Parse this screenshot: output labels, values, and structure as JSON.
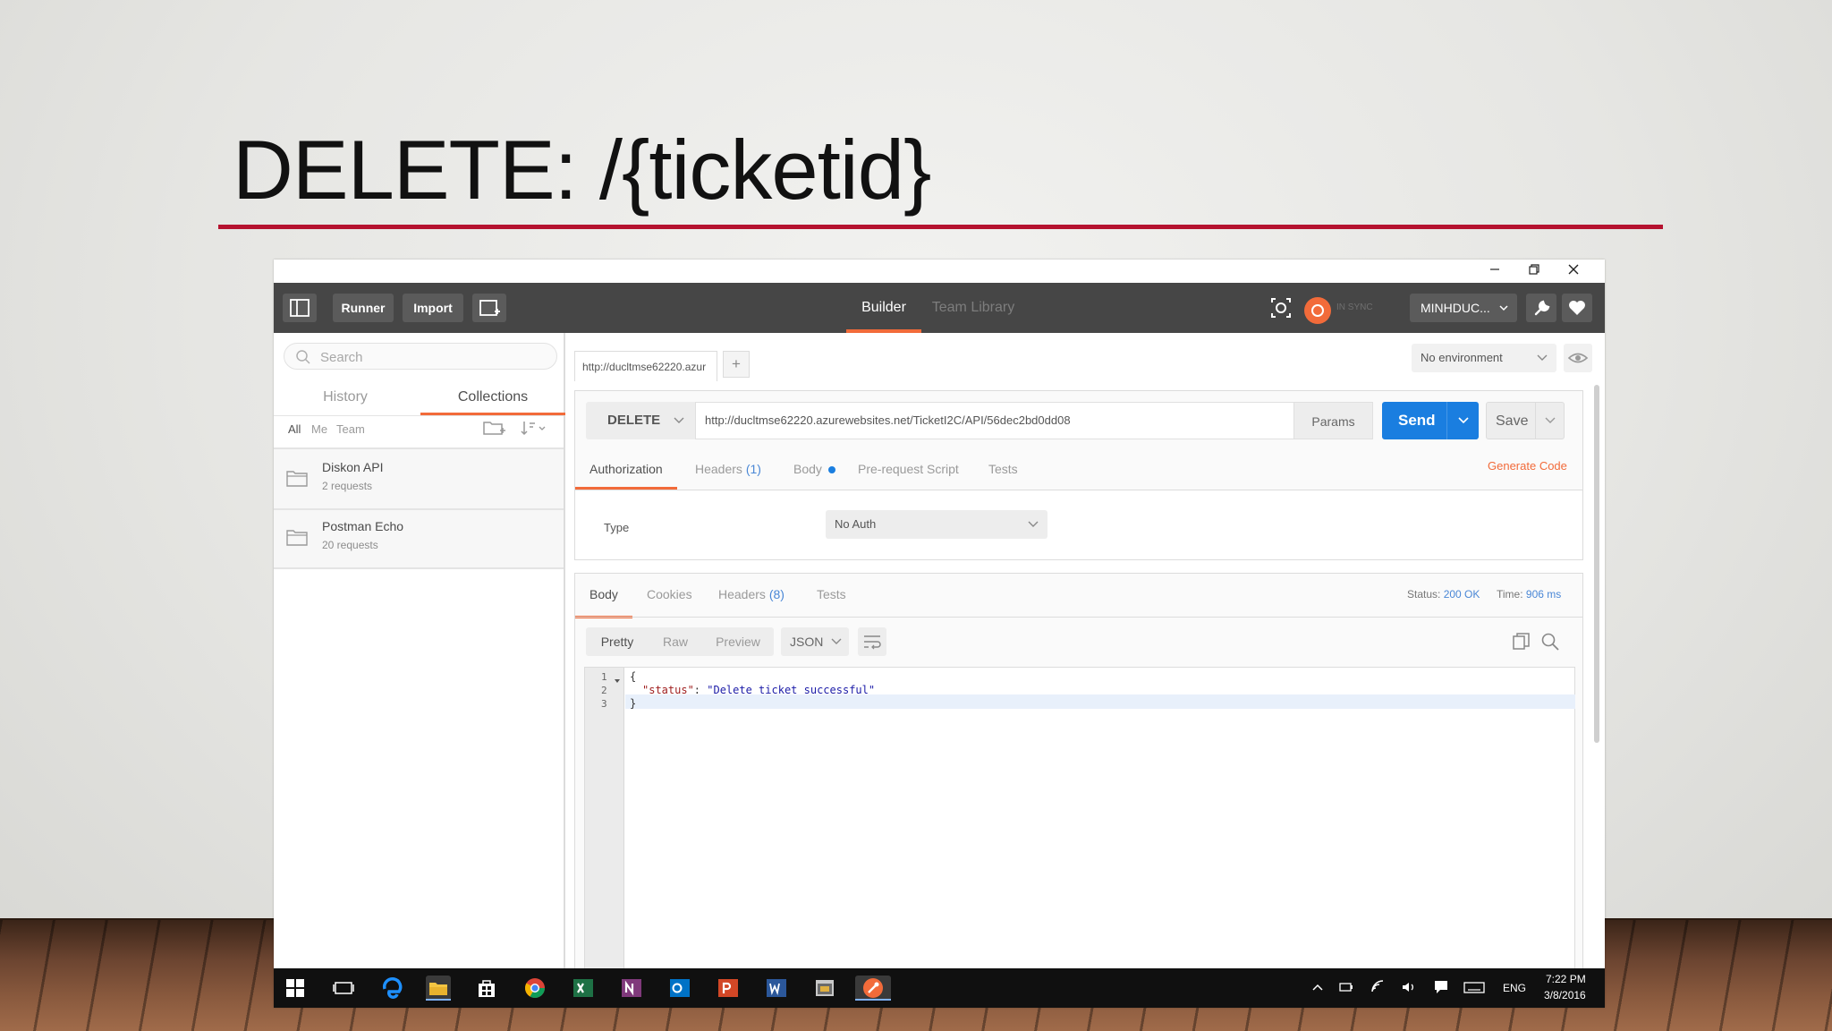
{
  "slide": {
    "title": "DELETE: /{ticketid}"
  },
  "toolbar": {
    "runner_label": "Runner",
    "import_label": "Import",
    "builder_tab": "Builder",
    "team_library_tab": "Team Library",
    "sync_status": "IN SYNC",
    "user_label": "MINHDUC..."
  },
  "sidebar": {
    "search_placeholder": "Search",
    "tabs": [
      "History",
      "Collections"
    ],
    "filters": [
      "All",
      "Me",
      "Team"
    ],
    "collections": [
      {
        "name": "Diskon API",
        "count": "2 requests"
      },
      {
        "name": "Postman Echo",
        "count": "20 requests"
      }
    ]
  },
  "request": {
    "tab_label": "http://ducltmse62220.azur",
    "add_tab": "+",
    "environment": "No environment",
    "method": "DELETE",
    "url": "http://ducltmse62220.azurewebsites.net/TicketI2C/API/56dec2bd0dd08",
    "params_label": "Params",
    "send_label": "Send",
    "save_label": "Save",
    "tabs": {
      "authorization": "Authorization",
      "headers": "Headers",
      "headers_count": "(1)",
      "body": "Body",
      "pre_request": "Pre-request Script",
      "tests": "Tests"
    },
    "generate_code": "Generate Code",
    "auth": {
      "type_label": "Type",
      "type_value": "No Auth"
    }
  },
  "response": {
    "tabs": {
      "body": "Body",
      "cookies": "Cookies",
      "headers": "Headers",
      "headers_count": "(8)",
      "tests": "Tests"
    },
    "status_label": "Status:",
    "status_value": "200 OK",
    "time_label": "Time:",
    "time_value": "906 ms",
    "formats": [
      "Pretty",
      "Raw",
      "Preview"
    ],
    "language": "JSON",
    "lines": [
      {
        "num": "1",
        "text": "{"
      },
      {
        "num": "2",
        "key": "\"status\"",
        "sep": ": ",
        "value": "\"Delete ticket successful\""
      },
      {
        "num": "3",
        "text": "}"
      }
    ]
  },
  "taskbar": {
    "language": "ENG",
    "time": "7:22 PM",
    "date": "3/8/2016"
  },
  "colors": {
    "accent": "#f26b3a",
    "send": "#1a7ee0",
    "title_rule": "#b5122f",
    "toolbar": "#464646"
  }
}
